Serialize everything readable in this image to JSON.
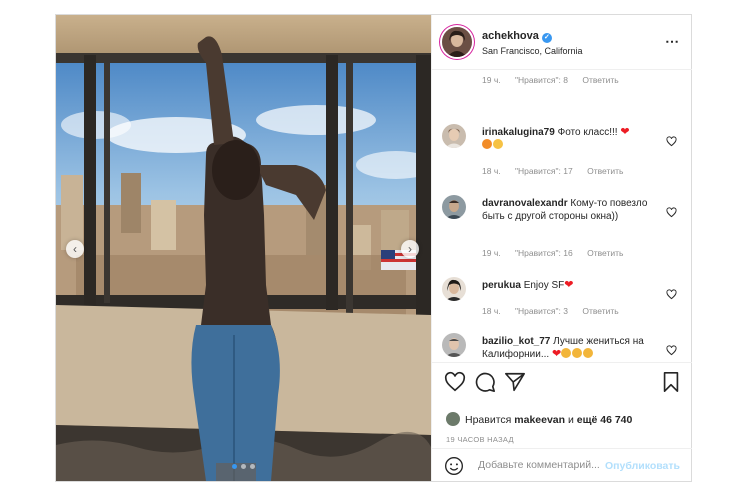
{
  "post": {
    "username": "achekhova",
    "location": "San Francisco, California",
    "more_icon": "⋯",
    "carousel_dots": 3,
    "active_dot": 0,
    "comments": [
      {
        "user": "",
        "text": "",
        "time": "19 ч.",
        "likes": "\"Нравится\": 8",
        "reply": "Ответить"
      },
      {
        "user": "irinakalugina79",
        "text": "Фото класс!!!",
        "time": "18 ч.",
        "likes": "\"Нравится\": 17",
        "reply": "Ответить"
      },
      {
        "user": "davranovalexandr",
        "text": "Кому-то повезло быть с другой стороны окна))",
        "time": "19 ч.",
        "likes": "\"Нравится\": 16",
        "reply": "Ответить"
      },
      {
        "user": "perukua",
        "text": "Enjoy SF",
        "time": "18 ч.",
        "likes": "\"Нравится\": 3",
        "reply": "Ответить"
      },
      {
        "user": "bazilio_kot_77",
        "text": "Лучше жениться на Калифорнии...",
        "time": "",
        "likes": "",
        "reply": ""
      }
    ],
    "likes_prefix": "Нравится",
    "likes_user": "makeevan",
    "likes_middle": "и",
    "likes_count": "ещё 46 740",
    "time_ago": "19 ЧАСОВ НАЗАД",
    "comment_placeholder": "Добавьте комментарий...",
    "publish_label": "Опубликовать"
  }
}
